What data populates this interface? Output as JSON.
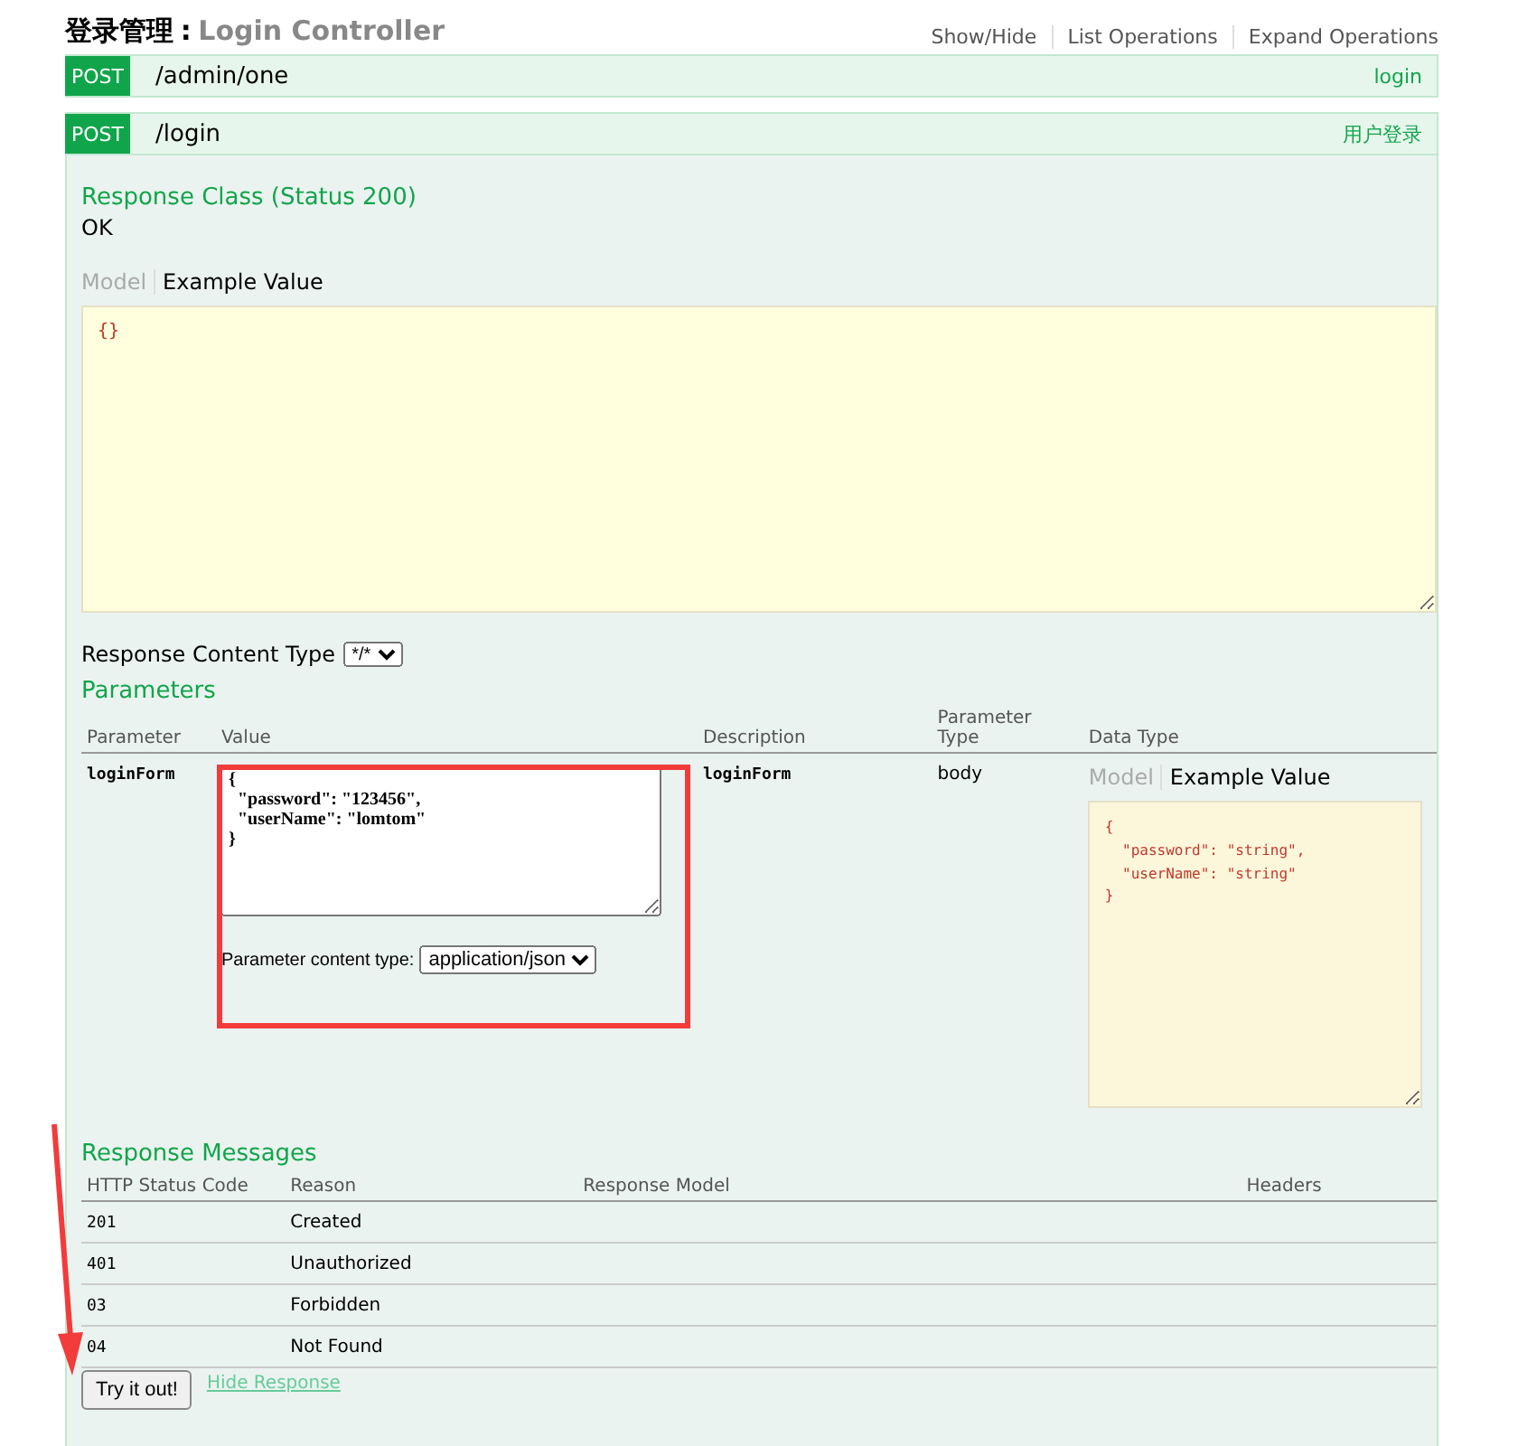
{
  "header": {
    "title": "登录管理",
    "separator": ":",
    "subtitle": "Login Controller",
    "links": [
      "Show/Hide",
      "List Operations",
      "Expand Operations"
    ]
  },
  "operations": [
    {
      "method": "POST",
      "path": "/admin/one",
      "summary": "login",
      "expanded": false
    },
    {
      "method": "POST",
      "path": "/login",
      "summary": "用户登录",
      "expanded": true
    }
  ],
  "response_class": {
    "title": "Response Class (Status 200)",
    "value": "OK",
    "tabs": [
      {
        "label": "Model",
        "selected": false
      },
      {
        "label": "Example Value",
        "selected": true
      }
    ],
    "example": "{}"
  },
  "response_content_type": {
    "label": "Response Content Type",
    "value": "*/*"
  },
  "parameters": {
    "title": "Parameters",
    "columns": [
      "Parameter",
      "Value",
      "Description",
      "Parameter Type",
      "Data Type"
    ],
    "rows": [
      {
        "parameter": "loginForm",
        "value": "{\n  \"password\": \"123456\",\n  \"userName\": \"lomtom\"\n}",
        "content_type_label": "Parameter content type:",
        "content_type": "application/json",
        "description": "loginForm",
        "parameter_type": "body",
        "tabs": [
          {
            "label": "Model",
            "selected": false
          },
          {
            "label": "Example Value",
            "selected": true
          }
        ],
        "example": "{\n  \"password\": \"string\",\n  \"userName\": \"string\"\n}"
      }
    ]
  },
  "response_messages": {
    "title": "Response Messages",
    "columns": [
      "HTTP Status Code",
      "Reason",
      "Response Model",
      "Headers"
    ],
    "rows": [
      {
        "code": "201",
        "reason": "Created"
      },
      {
        "code": "401",
        "reason": "Unauthorized"
      },
      {
        "code": "03",
        "reason": "Forbidden"
      },
      {
        "code": "04",
        "reason": "Not Found"
      }
    ]
  },
  "buttons": {
    "try": "Try it out!",
    "hide": "Hide Response"
  }
}
